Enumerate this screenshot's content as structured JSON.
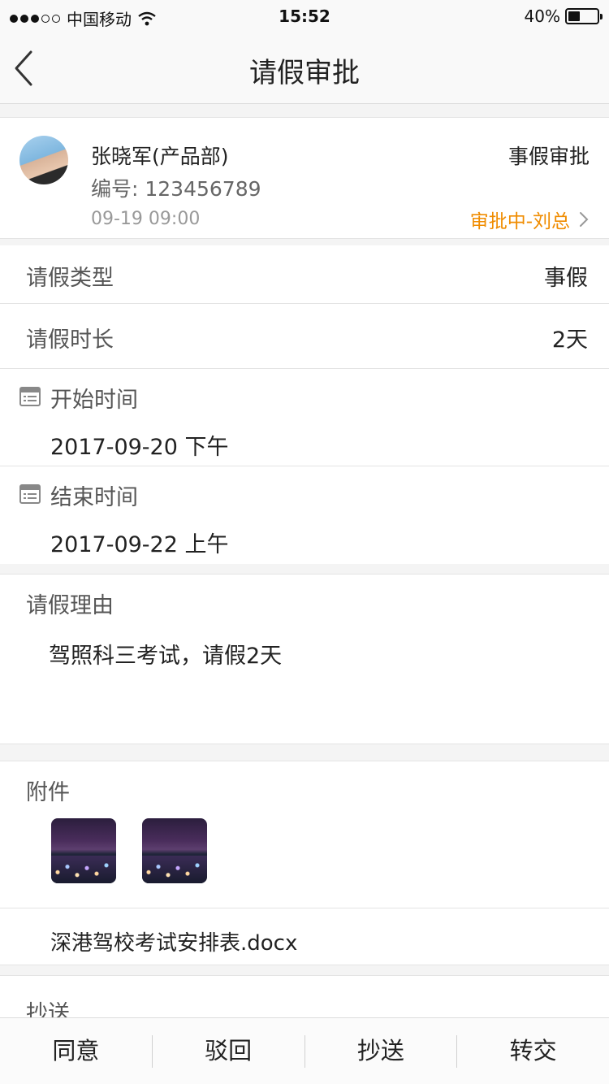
{
  "status_bar": {
    "carrier": "中国移动",
    "time": "15:52",
    "battery_percent_text": "40%",
    "battery_level": 0.4
  },
  "nav": {
    "title": "请假审批",
    "back_icon": "chevron-left-icon"
  },
  "applicant": {
    "name": "张晓军(产品部)",
    "id_text": "编号: 123456789",
    "submit_time": "09-19 09:00",
    "leave_category": "事假审批",
    "status": "审批中-刘总"
  },
  "details": {
    "type_label": "请假类型",
    "type_value": "事假",
    "duration_label": "请假时长",
    "duration_value": "2天",
    "start_label": "开始时间",
    "start_value": "2017-09-20 下午",
    "end_label": "结束时间",
    "end_value": "2017-09-22 上午"
  },
  "reason": {
    "label": "请假理由",
    "text": "驾照科三考试，请假2天"
  },
  "attachments": {
    "label": "附件",
    "file_name": "深港驾校考试安排表.docx"
  },
  "cc": {
    "label": "抄送"
  },
  "actions": {
    "agree": "同意",
    "reject": "驳回",
    "cc": "抄送",
    "transfer": "转交"
  },
  "colors": {
    "accent": "#f08c00",
    "background": "#f4f4f4"
  }
}
